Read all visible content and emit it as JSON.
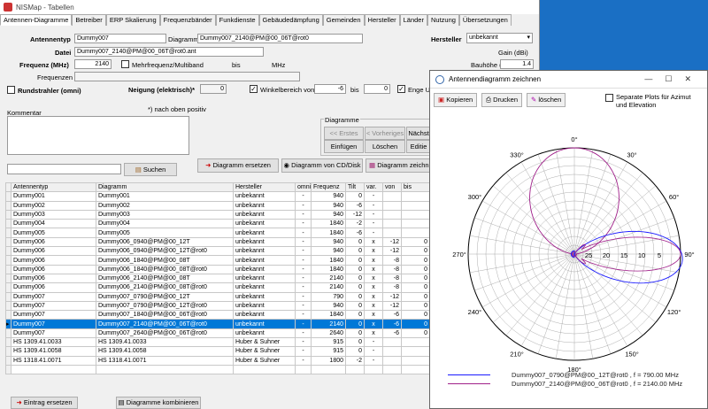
{
  "window_title": "NISMap - Tabellen",
  "tabs": [
    "Antennen-Diagramme",
    "Betreiber",
    "ERP Skalierung",
    "Frequenzbänder",
    "Funkdienste",
    "Gebäudedämpfung",
    "Gemeinden",
    "Hersteller",
    "Länder",
    "Nutzung",
    "Übersetzungen"
  ],
  "form": {
    "antennentyp_label": "Antennentyp",
    "antennentyp": "Dummy007",
    "diagramm_label": "Diagramm",
    "diagramm": "Dummy007_2140@PM@00_06T@rot0",
    "hersteller_label": "Hersteller",
    "hersteller": "unbekannt",
    "datei_label": "Datei",
    "datei": "Dummy007_2140@PM@00_06T@rot0.ant",
    "gain_label": "Gain (dBi)",
    "gain": "",
    "frequenz_label": "Frequenz (MHz)",
    "frequenz": "2140",
    "multifrequenz_label": "Mehrfrequenz/Multiband",
    "bis_label": "bis",
    "mhz_label": "MHz",
    "bauhoehe_label": "Bauhöhe (m)",
    "bauhoehe": "1.4",
    "frequenzen_label": "Frequenzen",
    "rundstrahler_label": "Rundstrahler (omni)",
    "neigung_label": "Neigung (elektrisch)*",
    "neigung": "0",
    "winkelbereich_label": "Winkelbereich von",
    "winkel_von": "-6",
    "winkel_bis_label": "bis",
    "winkel_bis": "0",
    "enge_label": "Enge Um",
    "hinweis": "*) nach oben positiv",
    "kommentar_label": "Kommentar",
    "search_button": "Suchen",
    "diagramm_group": "Diagramme",
    "erstes": "<< Erstes",
    "vorheriges": "< Vorheriges",
    "naechste": "Nächst",
    "einfuegen": "Einfügen",
    "loeschen": "Löschen",
    "editieren": "Editie",
    "diagramm_ersetzen": "Diagramm ersetzen",
    "diagramm_cd": "Diagramm von CD/Disk",
    "diagramm_zeichnen": "Diagramm zeichn"
  },
  "table": {
    "headers": [
      "Antennentyp",
      "Diagramm",
      "Hersteller",
      "omni",
      "Frequenz",
      "Tilt",
      "var.",
      "von",
      "bis"
    ],
    "rows": [
      [
        "Dummy001",
        "Dummy001",
        "unbekannt",
        "-",
        "940",
        "0",
        "-",
        "",
        ""
      ],
      [
        "Dummy002",
        "Dummy002",
        "unbekannt",
        "-",
        "940",
        "-6",
        "-",
        "",
        ""
      ],
      [
        "Dummy003",
        "Dummy003",
        "unbekannt",
        "-",
        "940",
        "-12",
        "-",
        "",
        ""
      ],
      [
        "Dummy004",
        "Dummy004",
        "unbekannt",
        "-",
        "1840",
        "-2",
        "-",
        "",
        ""
      ],
      [
        "Dummy005",
        "Dummy005",
        "unbekannt",
        "-",
        "1840",
        "-6",
        "-",
        "",
        ""
      ],
      [
        "Dummy006",
        "Dummy006_0940@PM@00_12T",
        "unbekannt",
        "-",
        "940",
        "0",
        "x",
        "-12",
        "0"
      ],
      [
        "Dummy006",
        "Dummy006_0940@PM@00_12T@rot0",
        "unbekannt",
        "-",
        "940",
        "0",
        "x",
        "-12",
        "0"
      ],
      [
        "Dummy006",
        "Dummy006_1840@PM@00_08T",
        "unbekannt",
        "-",
        "1840",
        "0",
        "x",
        "-8",
        "0"
      ],
      [
        "Dummy006",
        "Dummy006_1840@PM@00_08T@rot0",
        "unbekannt",
        "-",
        "1840",
        "0",
        "x",
        "-8",
        "0"
      ],
      [
        "Dummy006",
        "Dummy006_2140@PM@00_08T",
        "unbekannt",
        "-",
        "2140",
        "0",
        "x",
        "-8",
        "0"
      ],
      [
        "Dummy006",
        "Dummy006_2140@PM@00_08T@rot0",
        "unbekannt",
        "-",
        "2140",
        "0",
        "x",
        "-8",
        "0"
      ],
      [
        "Dummy007",
        "Dummy007_0790@PM@00_12T",
        "unbekannt",
        "-",
        "790",
        "0",
        "x",
        "-12",
        "0"
      ],
      [
        "Dummy007",
        "Dummy007_0790@PM@00_12T@rot0",
        "unbekannt",
        "-",
        "940",
        "0",
        "x",
        "-12",
        "0"
      ],
      [
        "Dummy007",
        "Dummy007_1840@PM@00_06T@rot0",
        "unbekannt",
        "-",
        "1840",
        "0",
        "x",
        "-6",
        "0"
      ],
      [
        "Dummy007",
        "Dummy007_2140@PM@00_06T@rot0",
        "unbekannt",
        "-",
        "2140",
        "0",
        "x",
        "-6",
        "0"
      ],
      [
        "Dummy007",
        "Dummy007_2640@PM@00_06T@rot0",
        "unbekannt",
        "-",
        "2640",
        "0",
        "x",
        "-6",
        "0"
      ],
      [
        "HS 1309.41.0033",
        "HS 1309.41.0033",
        "Huber & Suhner",
        "-",
        "915",
        "0",
        "-",
        "",
        ""
      ],
      [
        "HS 1309.41.0058",
        "HS 1309.41.0058",
        "Huber & Suhner",
        "-",
        "915",
        "0",
        "-",
        "",
        ""
      ],
      [
        "HS 1318.41.0071",
        "HS 1318.41.0071",
        "Huber & Suhner",
        "-",
        "1800",
        "-2",
        "-",
        "",
        ""
      ]
    ],
    "selected_index": 14
  },
  "bottom": {
    "eintrag_ersetzen": "Eintrag ersetzen",
    "diagramme_kombinieren": "Diagramme kombinieren"
  },
  "dialog": {
    "title": "Antennendiagramm zeichnen",
    "kopieren": "Kopieren",
    "drucken": "Drucken",
    "loeschen": "löschen",
    "separate_label": "Separate Plots für Azimut und Elevation",
    "angle_labels": {
      "a0": "0°",
      "a30": "30°",
      "a60": "60°",
      "a90": "90°",
      "a120": "120°",
      "a150": "150°",
      "a180": "180°",
      "a210": "210°",
      "a240": "240°",
      "a270": "270°",
      "a300": "300°",
      "a330": "330°"
    },
    "ring_labels": [
      "25",
      "20",
      "15",
      "10",
      "5"
    ],
    "legend": [
      {
        "label": "Dummy007_0790@PM@00_12T@rot0 ,  f = 790.00 MHz",
        "color": "#1a1aff"
      },
      {
        "label": "Dummy007_2140@PM@00_06T@rot0 ,  f = 2140.00 MHz",
        "color": "#a0208a"
      }
    ]
  }
}
